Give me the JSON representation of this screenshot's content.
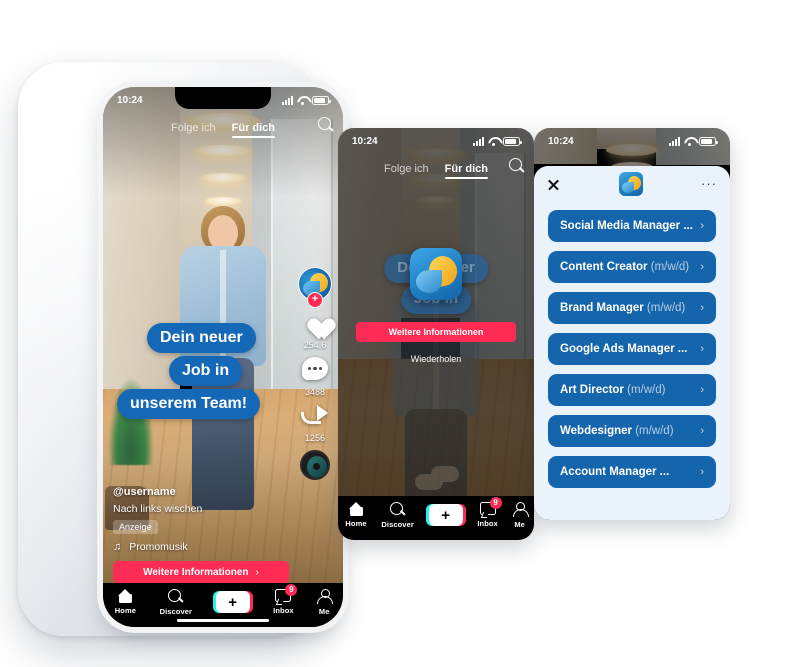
{
  "phone1": {
    "status_bar": {
      "time": "10:24",
      "signal_icon": "signal-icon",
      "wifi_icon": "wifi-icon",
      "battery_icon": "battery-icon"
    },
    "feed_tabs": [
      {
        "label": "Folge ich",
        "active": false
      },
      {
        "label": "Für dich",
        "active": true
      }
    ],
    "search_icon": "search-icon",
    "bubble_lines": [
      "Dein neuer",
      "Job in",
      "unserem Team!"
    ],
    "rail": {
      "avatar_icon": "avatar-icon",
      "follow_plus_label": "+",
      "like_icon": "heart-icon",
      "like_count": "254.6",
      "comment_icon": "comment-icon",
      "comment_count": "3488",
      "share_icon": "share-icon",
      "share_count": "1256",
      "music_disc_icon": "music-disc-icon"
    },
    "meta": {
      "username": "@username",
      "description": "Nach links wischen",
      "ad_badge": "Anzeige",
      "music_icon": "music-note-icon",
      "music_title": "Promomusik"
    },
    "cta": {
      "label": "Weitere Informationen",
      "chevron": "›"
    },
    "tabbar": [
      {
        "label": "Home",
        "icon": "home-icon"
      },
      {
        "label": "Discover",
        "icon": "search-icon"
      },
      {
        "label": "",
        "icon": "create-plus-icon",
        "plus": "+"
      },
      {
        "label": "Inbox",
        "icon": "inbox-icon",
        "badge": "9"
      },
      {
        "label": "Me",
        "icon": "person-icon"
      }
    ]
  },
  "phone2": {
    "status_bar": {
      "time": "10:24"
    },
    "feed_tabs": [
      {
        "label": "Folge ich",
        "active": false
      },
      {
        "label": "Für dich",
        "active": true
      }
    ],
    "search_icon": "search-icon",
    "app_icon": "brand-app-icon",
    "bubble_lines": [
      "Dein neuer",
      "Job in"
    ],
    "cta": {
      "label": "Weitere Informationen"
    },
    "replay_label": "Wiederholen",
    "tabbar": [
      {
        "label": "Home",
        "icon": "home-icon"
      },
      {
        "label": "Discover",
        "icon": "search-icon"
      },
      {
        "label": "",
        "icon": "create-plus-icon",
        "plus": "+"
      },
      {
        "label": "Inbox",
        "icon": "inbox-icon",
        "badge": "9"
      },
      {
        "label": "Me",
        "icon": "person-icon"
      }
    ]
  },
  "phone3": {
    "status_bar": {
      "time": "10:24"
    },
    "modal": {
      "close_icon": "close-icon",
      "app_icon": "brand-app-icon",
      "more_icon": "more-options-icon",
      "more_label": "···"
    },
    "jobs": [
      {
        "title": "Social Media Manager ...",
        "suffix": "",
        "chevron": "›"
      },
      {
        "title": "Content Creator ",
        "suffix": "(m/w/d)",
        "chevron": "›"
      },
      {
        "title": "Brand Manager ",
        "suffix": "(m/w/d)",
        "chevron": "›"
      },
      {
        "title": "Google Ads Manager ...",
        "suffix": "",
        "chevron": "›"
      },
      {
        "title": "Art Director ",
        "suffix": "(m/w/d)",
        "chevron": "›"
      },
      {
        "title": "Webdesigner ",
        "suffix": "(m/w/d)",
        "chevron": "›"
      },
      {
        "title": "Account Manager ...",
        "suffix": "",
        "chevron": "›"
      }
    ]
  },
  "colors": {
    "brand_blue": "#1565ad",
    "bubble_blue": "#1568b6",
    "accent_pink": "#fe2c55",
    "sheet_bg": "#eaf2fb",
    "tabbar_bg": "#000000"
  }
}
